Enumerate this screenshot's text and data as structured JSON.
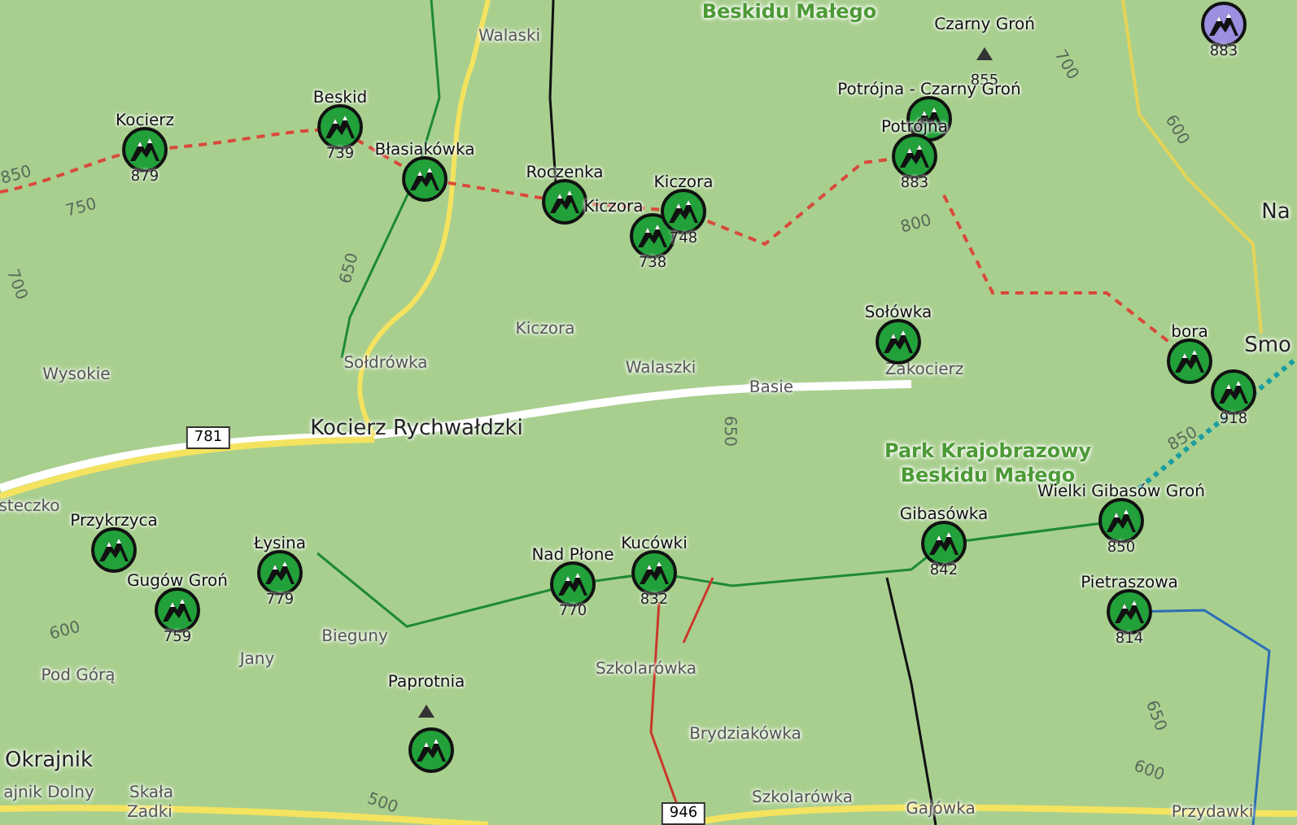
{
  "map": {
    "peaks": [
      {
        "kind": "marker",
        "elevation": "883",
        "color": "#9b8fe0"
      },
      {
        "kind": "summit",
        "name": "Czarny Groń",
        "elevation": "855"
      },
      {
        "kind": "marker",
        "name": "Beskid",
        "elevation": "739",
        "color": "#22a03a"
      },
      {
        "kind": "marker",
        "name": "Potrójna - Czarny Groń",
        "color": "#22a03a"
      },
      {
        "kind": "marker",
        "name": "Kocierz",
        "elevation": "879",
        "color": "#22a03a"
      },
      {
        "kind": "marker",
        "name": "Błasiakówka",
        "color": "#22a03a"
      },
      {
        "kind": "marker",
        "name": "Roczenka",
        "color": "#22a03a"
      },
      {
        "kind": "marker",
        "name": "Kiczora",
        "elevation": "738",
        "color": "#22a03a"
      },
      {
        "kind": "marker",
        "name": "Kiczora",
        "elevation": "748",
        "color": "#22a03a"
      },
      {
        "kind": "marker",
        "name": "Potrójna",
        "elevation": "883",
        "color": "#22a03a"
      },
      {
        "kind": "marker",
        "name": "Sołówka",
        "color": "#22a03a"
      },
      {
        "kind": "marker",
        "name": "bora",
        "color": "#22a03a"
      },
      {
        "kind": "marker",
        "elevation": "918",
        "color": "#22a03a"
      },
      {
        "kind": "marker",
        "name": "Przykrzyca",
        "color": "#22a03a"
      },
      {
        "kind": "marker",
        "name": "Łysina",
        "elevation": "779",
        "color": "#22a03a"
      },
      {
        "kind": "marker",
        "name": "Nad Płone",
        "elevation": "770",
        "color": "#22a03a"
      },
      {
        "kind": "marker",
        "name": "Kucówki",
        "elevation": "832",
        "color": "#22a03a"
      },
      {
        "kind": "marker",
        "name": "Gibasówka",
        "elevation": "842",
        "color": "#22a03a"
      },
      {
        "kind": "marker",
        "name": "Wielki Gibasów Groń",
        "elevation": "850",
        "color": "#22a03a"
      },
      {
        "kind": "marker",
        "name": "Gugów Groń",
        "elevation": "759",
        "color": "#22a03a"
      },
      {
        "kind": "marker",
        "name": "Pietraszowa",
        "elevation": "814",
        "color": "#22a03a"
      },
      {
        "kind": "summit",
        "name": "Paprotnia"
      },
      {
        "kind": "marker",
        "color": "#22a03a"
      }
    ],
    "places": [
      {
        "kind": "park",
        "name": "Beskidu Małego"
      },
      {
        "kind": "hamlet",
        "name": "Walaski"
      },
      {
        "kind": "village",
        "name": "Na"
      },
      {
        "kind": "hamlet",
        "name": "Kiczora"
      },
      {
        "kind": "hamlet",
        "name": "Wysokie"
      },
      {
        "kind": "hamlet",
        "name": "Sołdrówka"
      },
      {
        "kind": "hamlet",
        "name": "Walaszki"
      },
      {
        "kind": "hamlet",
        "name": "Basie"
      },
      {
        "kind": "hamlet",
        "name": "Zakocierz"
      },
      {
        "kind": "village",
        "name": "Smo"
      },
      {
        "kind": "village",
        "name": "Kocierz Rychwałdzki"
      },
      {
        "kind": "park",
        "name": "Park Krajobrazowy Beskidu Małego"
      },
      {
        "kind": "hamlet",
        "name": "steczko"
      },
      {
        "kind": "hamlet",
        "name": "Bieguny"
      },
      {
        "kind": "hamlet",
        "name": "Pod Górą"
      },
      {
        "kind": "hamlet",
        "name": "Jany"
      },
      {
        "kind": "hamlet",
        "name": "Szkolarówka"
      },
      {
        "kind": "hamlet",
        "name": "Brydziakówka"
      },
      {
        "kind": "village",
        "name": "Okrajnik"
      },
      {
        "kind": "hamlet",
        "name": "ajnik Dolny"
      },
      {
        "kind": "hamlet",
        "name": "Skała"
      },
      {
        "kind": "hamlet",
        "name": "Zadki"
      },
      {
        "kind": "hamlet",
        "name": "Szkolarówka"
      },
      {
        "kind": "hamlet",
        "name": "Gajówka"
      },
      {
        "kind": "hamlet",
        "name": "Przydawki"
      }
    ],
    "road_shields": [
      "781",
      "946"
    ],
    "contour_labels": [
      "850",
      "750",
      "700",
      "650",
      "650",
      "700",
      "600",
      "800",
      "850",
      "650",
      "600",
      "600",
      "500"
    ]
  }
}
